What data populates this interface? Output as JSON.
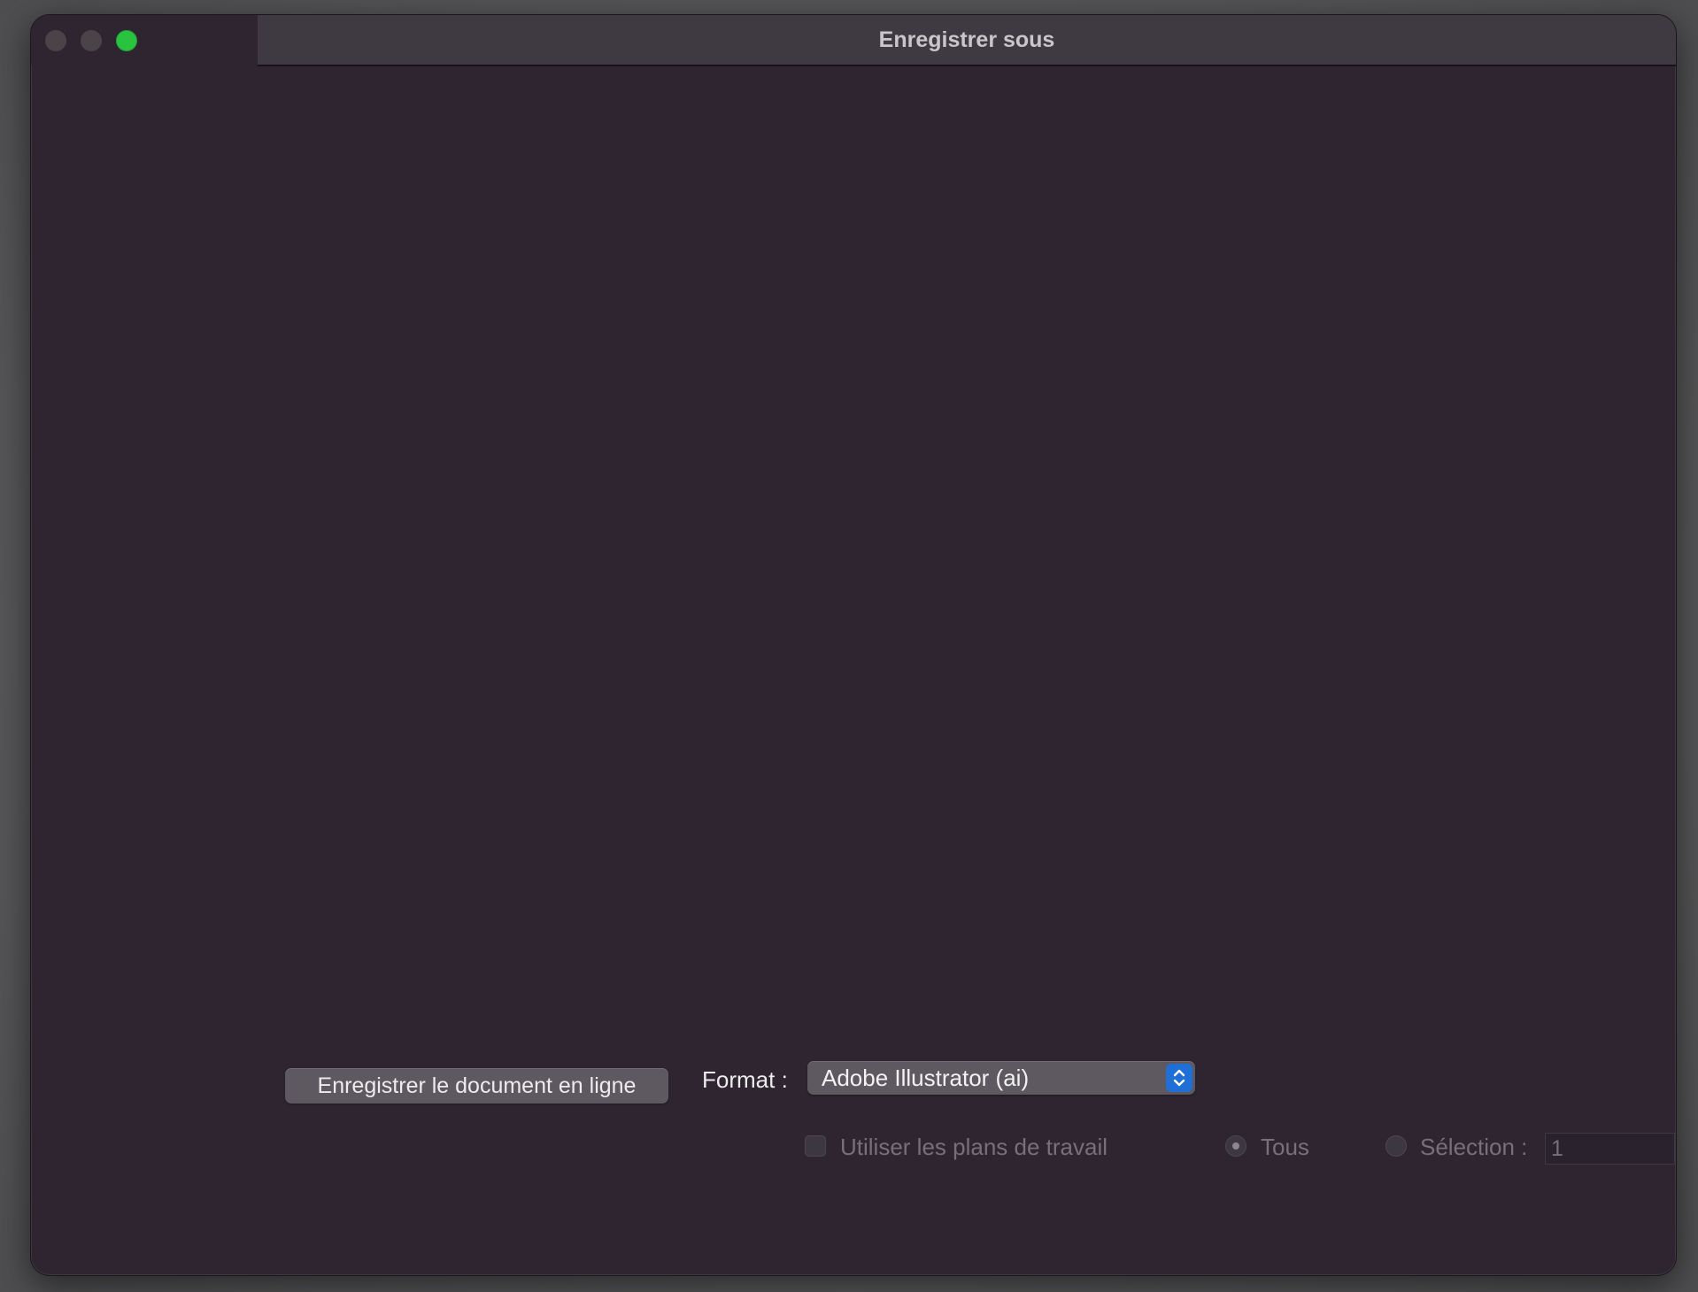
{
  "window": {
    "title": "Enregistrer sous",
    "controls": [
      "close",
      "minimize",
      "zoom"
    ],
    "zoom_color": "#29c33f"
  },
  "footer": {
    "online_button_label": "Enregistrer le document en ligne",
    "format_label": "Format :",
    "format_value": "Adobe Illustrator (ai)",
    "use_artboards_label": "Utiliser les plans de travail",
    "use_artboards_checked": false,
    "radio_all_label": "Tous",
    "radio_selection_label": "Sélection :",
    "selection_range_value": "1",
    "accent_color": "#1f6fd6"
  }
}
